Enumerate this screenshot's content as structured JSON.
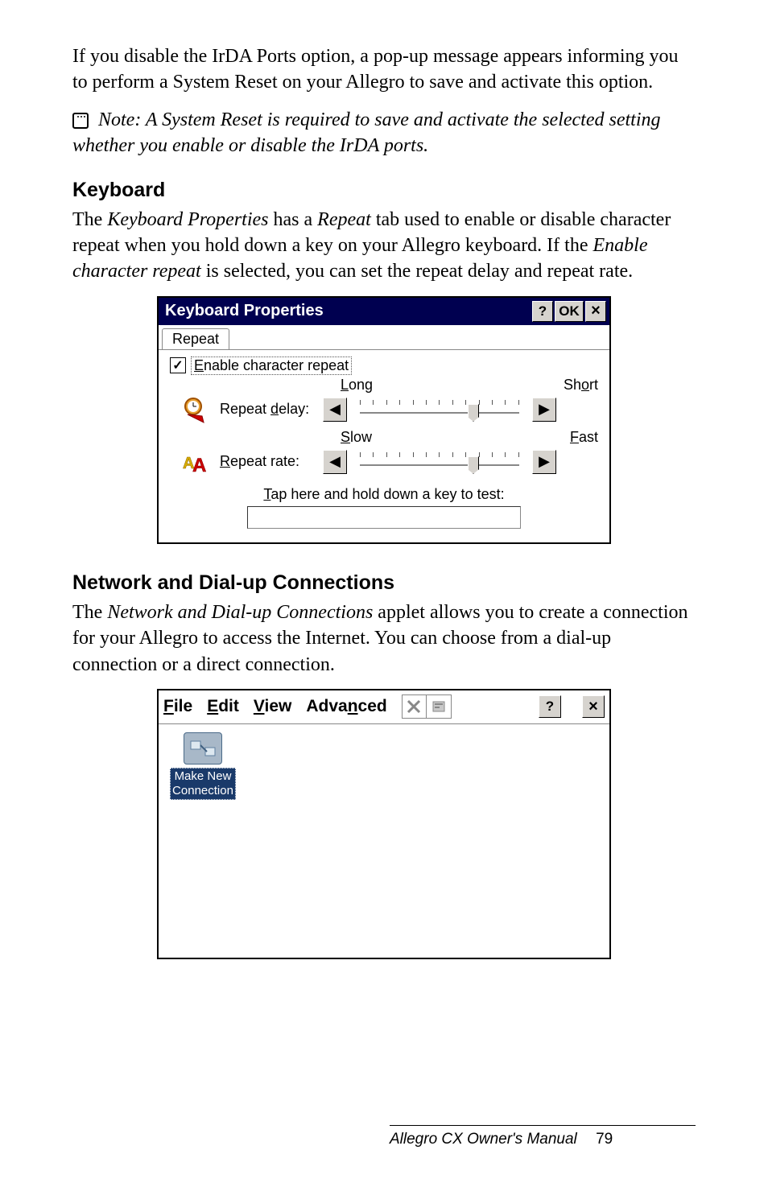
{
  "intro_para": "If you disable the IrDA Ports option, a pop-up message appears informing you to perform a System Reset on your Allegro to save and activate this option.",
  "note_text": "Note: A System Reset is required to save and activate the selected setting whether you enable or disable the IrDA ports.",
  "heading_keyboard": "Keyboard",
  "keyboard_para_pre": "The ",
  "keyboard_para_kp": "Keyboard Properties",
  "keyboard_para_mid1": " has a ",
  "keyboard_para_repeat": "Repeat",
  "keyboard_para_mid2": " tab used to enable or disable character repeat when you hold down a key on your Allegro keyboard. If the ",
  "keyboard_para_ecr": "Enable character repeat",
  "keyboard_para_end": " is selected, you can set the repeat delay and repeat rate.",
  "win1": {
    "title": "Keyboard Properties",
    "help": "?",
    "ok": "OK",
    "close": "×",
    "tab": "Repeat",
    "checkbox_mark": "✓",
    "checkbox_label_pre": "E",
    "checkbox_label_rest": "nable character repeat",
    "long_pre": "L",
    "long_rest": "ong",
    "short_pre": "o",
    "short_prefix": "Sh",
    "short_rest": "rt",
    "rd_label_pre": "Repeat ",
    "rd_label_ul": "d",
    "rd_label_rest": "elay:",
    "slow_pre": "S",
    "slow_rest": "low",
    "fast_pre": "F",
    "fast_rest": "ast",
    "rr_label_pre": "R",
    "rr_label_rest": "epeat rate:",
    "test_pre": "T",
    "test_rest": "ap here and hold down a key to test:",
    "left_arrow": "◀",
    "right_arrow": "▶"
  },
  "heading_network": "Network and Dial-up Connections",
  "network_para_pre": "The ",
  "network_para_title": "Network and Dial-up Connections",
  "network_para_rest": " applet allows you to create a connection for your Allegro to access the Internet. You can choose from a dial-up connection or a direct connection.",
  "win2": {
    "file_pre": "F",
    "file_rest": "ile",
    "edit_pre": "E",
    "edit_rest": "dit",
    "view_pre": "V",
    "view_rest": "iew",
    "adv_pre": "Adva",
    "adv_ul": "n",
    "adv_rest": "ced",
    "help": "?",
    "close": "×",
    "item_label": "Make New\nConnection"
  },
  "footer_text": "Allegro CX Owner's Manual",
  "footer_page": "79"
}
